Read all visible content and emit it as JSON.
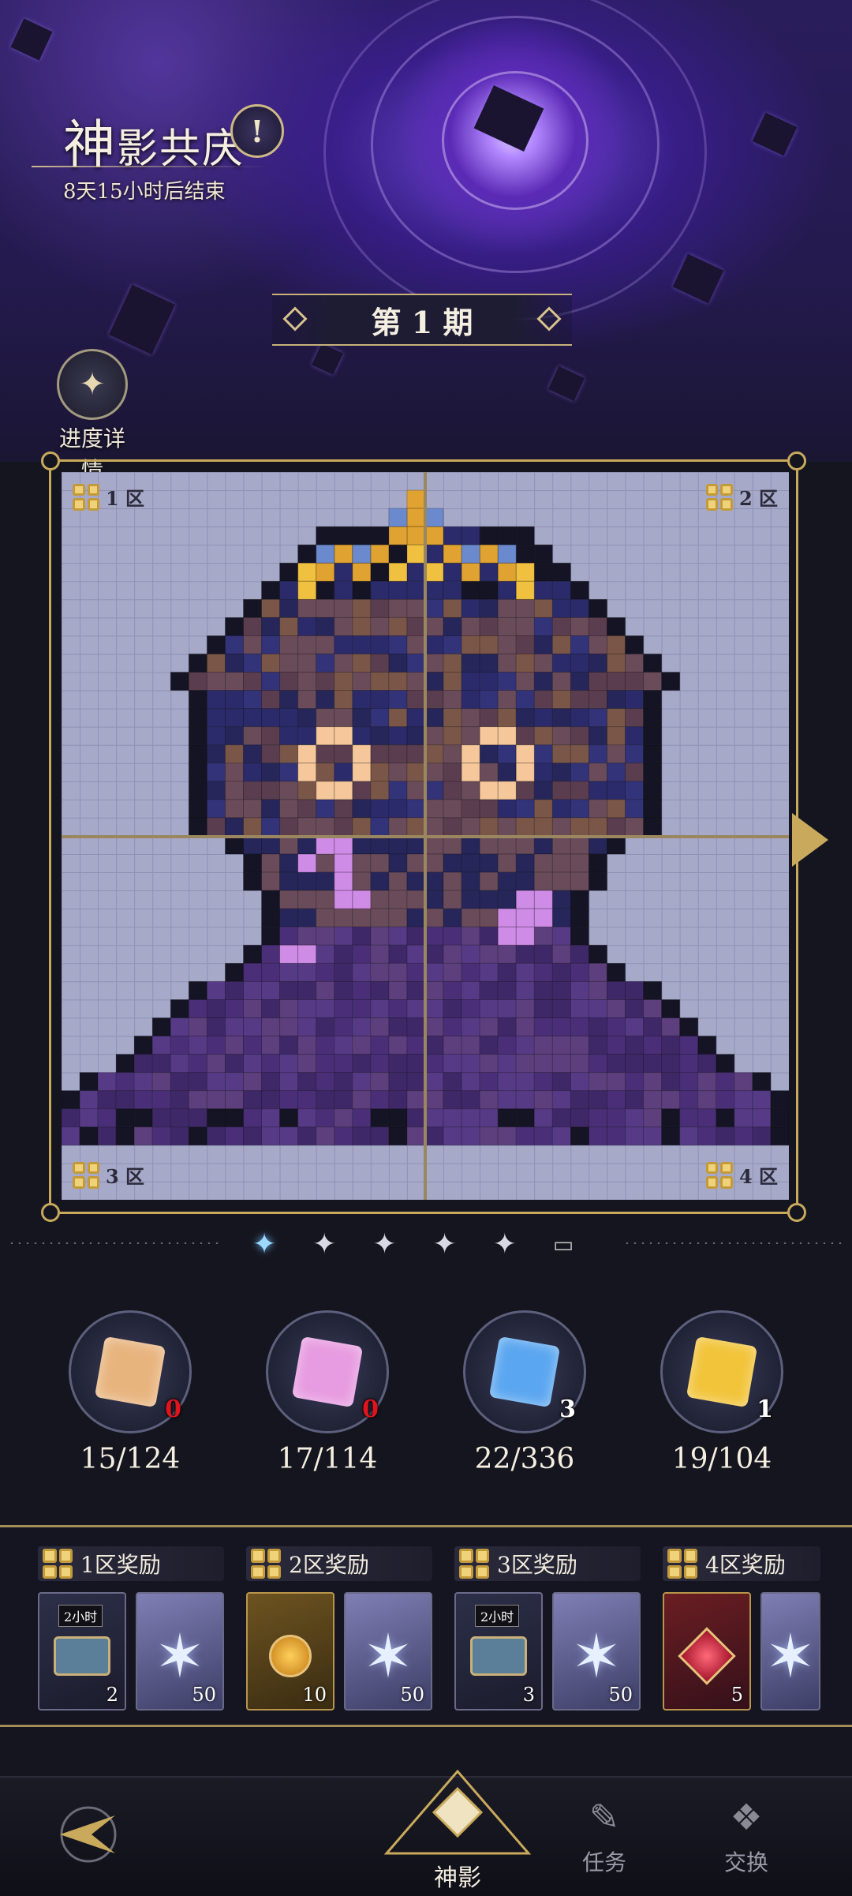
{
  "event": {
    "title_big": "神",
    "title_rest": "影共庆",
    "countdown": "8天15小时后结束",
    "info_icon": "exclamation-icon",
    "period": "第 1 期",
    "progress_label": "进度详情"
  },
  "board": {
    "zones": [
      "1 区",
      "2 区",
      "3 区",
      "4 区"
    ],
    "active_page_index": 0,
    "page_count": 6
  },
  "cubes": [
    {
      "name": "orange-cube",
      "color": "#e8b47e",
      "count": "0",
      "count_color": "#e0141c",
      "progress": "15/124"
    },
    {
      "name": "pink-cube",
      "color": "#e79be0",
      "count": "0",
      "count_color": "#e0141c",
      "progress": "17/114"
    },
    {
      "name": "blue-cube",
      "color": "#5aa6f0",
      "count": "3",
      "count_color": "#ffffff",
      "progress": "22/336"
    },
    {
      "name": "gold-cube",
      "color": "#f2c43a",
      "count": "1",
      "count_color": "#ffffff",
      "progress": "19/104"
    }
  ],
  "rewards": [
    {
      "label": "1区奖励",
      "items": [
        {
          "icon": "treasure-chest-icon",
          "tag": "2小时",
          "count": "2"
        },
        {
          "icon": "crystal-star-icon",
          "count": "50"
        }
      ]
    },
    {
      "label": "2区奖励",
      "items": [
        {
          "icon": "potion-staff-icon",
          "count": "10"
        },
        {
          "icon": "crystal-star-icon",
          "count": "50"
        }
      ]
    },
    {
      "label": "3区奖励",
      "items": [
        {
          "icon": "treasure-chest-icon",
          "tag": "2小时",
          "count": "3"
        },
        {
          "icon": "crystal-star-icon",
          "count": "50"
        }
      ]
    },
    {
      "label": "4区奖励",
      "items": [
        {
          "icon": "ruby-scepter-icon",
          "count": "5"
        },
        {
          "icon": "crystal-star-icon",
          "count": ""
        }
      ]
    }
  ],
  "nav": {
    "active": "神影",
    "task": "任务",
    "exchange": "交换"
  }
}
